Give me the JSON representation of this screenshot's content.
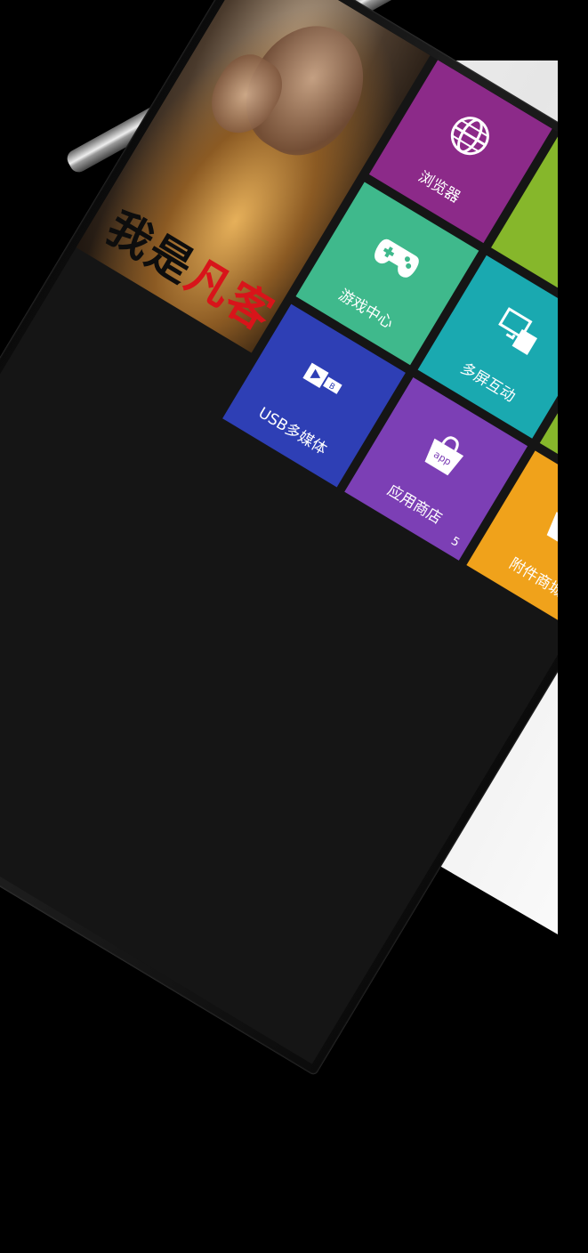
{
  "hero": {
    "title_part1": "我是",
    "title_part2": "凡客"
  },
  "tiles": {
    "browser": {
      "label": "浏览器",
      "icon": "globe-icon"
    },
    "game": {
      "label": "游戏中心",
      "icon": "gamepad-icon"
    },
    "multiscreen": {
      "label": "多屏互动",
      "icon": "screens-icon"
    },
    "usb": {
      "label": "USB多媒体",
      "icon": "usb-media-icon"
    },
    "store": {
      "label": "应用商店",
      "icon": "app-bag-icon",
      "badge": "5"
    },
    "mall": {
      "label": "附件商城",
      "icon": "shop-bag-icon"
    }
  },
  "colors": {
    "browser": "#8c2a89",
    "game": "#3fb98c",
    "multiscreen": "#1aa9b0",
    "usb": "#2e3fb5",
    "store": "#7c3fb5",
    "mall": "#f0a21b",
    "accent_red": "#d8141a"
  }
}
